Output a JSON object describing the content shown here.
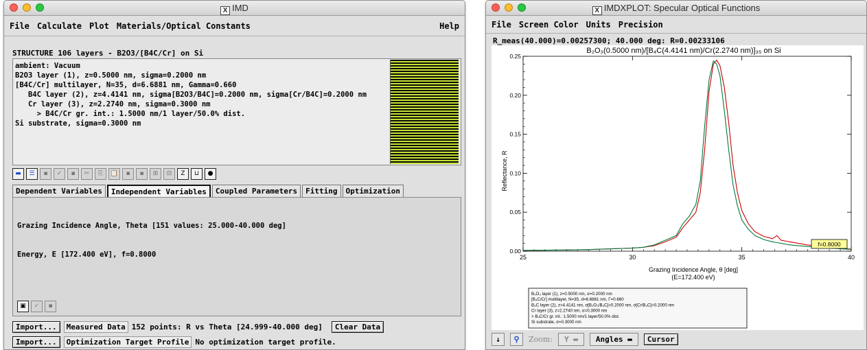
{
  "imd": {
    "title": "IMD",
    "menu": [
      "File",
      "Calculate",
      "Plot",
      "Materials/Optical Constants"
    ],
    "help": "Help",
    "structure_header": "STRUCTURE   106 layers - B2O3/[B4C/Cr] on Si",
    "structure_lines": [
      "ambient: Vacuum",
      "B2O3 layer (1), z=0.5000 nm, sigma=0.2000 nm",
      "[B4C/Cr] multilayer, N=35, d=6.6881 nm, Gamma=0.660",
      "   B4C layer (2), z=4.4141 nm, sigma[B2O3/B4C]=0.2000 nm, sigma[Cr/B4C]=0.2000 nm",
      "   Cr layer (3), z=2.2740 nm, sigma=0.3000 nm",
      "     > B4C/Cr gr. int.: 1.5000 nm/1 layer/50.0% dist.",
      "Si substrate, sigma=0.3000 nm"
    ],
    "tabs": [
      "Dependent Variables",
      "Independent Variables",
      "Coupled Parameters",
      "Fitting",
      "Optimization"
    ],
    "active_tab": "Independent Variables",
    "variables": [
      "Grazing Incidence Angle, Theta [151 values: 25.000-40.000 deg]",
      "Energy, E [172.400 eV], f=0.8000"
    ],
    "import_label": "Import...",
    "measured_label": "Measured Data",
    "measured_info": "152 points: R vs Theta [24.999-40.000 deg]",
    "clear_label": "Clear Data",
    "target_label": "Optimization Target Profile",
    "target_info": "No optimization target profile."
  },
  "xplot": {
    "title": "IMDXPLOT: Specular Optical Functions",
    "menu": [
      "File",
      "Screen Color",
      "Units",
      "Precision"
    ],
    "readout": "R_meas(40.000)=0.00257300; 40.000 deg: R=0.00233106",
    "legend_lines": [
      "B₂O₃ layer (1), z=0.5000 nm, σ=0.2000 nm",
      "[B₄C/Cr] multilayer, N=35, d=6.6881 nm, Γ=0.660",
      "   B₄C layer (2), z=4.4141 nm, σ[B₂O₃/B₄C]=0.2000 nm, σ[Cr/B₄C]=0.2000 nm",
      "   Cr layer (3), z=2.2740 nm, σ=0.3000 nm",
      "     > B₄C/Cr gr. int.: 1.5000 nm/1 layer/50.0% dist.",
      "Si substrate, σ=0.3000 nm"
    ],
    "zoom_label": "Zoom:",
    "zoom_value": "Y",
    "angles_label": "Angles",
    "cursor_label": "Cursor"
  },
  "chart_data": {
    "type": "line",
    "title": "B₂O₃(0.5000 nm)/[B₄C(4.4141 nm)/Cr(2.2740 nm)]₃₅ on Si",
    "xlabel": "Grazing Incidence Angle, θ [deg]",
    "xlabel2": "(E=172.400 eV)",
    "ylabel": "Reflectance, R",
    "xlim": [
      25,
      40
    ],
    "ylim": [
      0,
      0.25
    ],
    "xticks": [
      "25",
      "30",
      "35",
      "40"
    ],
    "yticks": [
      "0.00",
      "0.05",
      "0.10",
      "0.15",
      "0.20",
      "0.25"
    ],
    "annotation": "f=0.8000",
    "series": [
      {
        "color": "#cc0000",
        "x": [
          25,
          26,
          27,
          28,
          29,
          30,
          30.5,
          31,
          31.5,
          32,
          32.3,
          32.6,
          32.9,
          33.1,
          33.3,
          33.5,
          33.7,
          33.85,
          34,
          34.2,
          34.4,
          34.6,
          34.8,
          35,
          35.3,
          35.6,
          36,
          36.4,
          36.6,
          36.8,
          37.2,
          38,
          39,
          40
        ],
        "y": [
          0.001,
          0.0012,
          0.0015,
          0.002,
          0.003,
          0.004,
          0.005,
          0.007,
          0.012,
          0.018,
          0.03,
          0.04,
          0.05,
          0.075,
          0.13,
          0.205,
          0.24,
          0.245,
          0.238,
          0.21,
          0.165,
          0.11,
          0.075,
          0.052,
          0.035,
          0.025,
          0.019,
          0.016,
          0.02,
          0.014,
          0.012,
          0.008,
          0.005,
          0.0026
        ]
      },
      {
        "color": "#007a40",
        "x": [
          25,
          26,
          27,
          28,
          29,
          30,
          30.5,
          31,
          31.5,
          32,
          32.3,
          32.6,
          32.9,
          33.1,
          33.3,
          33.5,
          33.7,
          33.85,
          34,
          34.2,
          34.4,
          34.6,
          34.8,
          35,
          35.3,
          35.6,
          36,
          36.4,
          36.6,
          36.8,
          37.2,
          38,
          39,
          40
        ],
        "y": [
          0.001,
          0.0012,
          0.0015,
          0.002,
          0.003,
          0.004,
          0.005,
          0.008,
          0.014,
          0.02,
          0.035,
          0.045,
          0.06,
          0.09,
          0.16,
          0.22,
          0.244,
          0.24,
          0.225,
          0.18,
          0.13,
          0.085,
          0.058,
          0.04,
          0.028,
          0.02,
          0.015,
          0.012,
          0.011,
          0.01,
          0.008,
          0.006,
          0.004,
          0.0023
        ]
      }
    ]
  }
}
